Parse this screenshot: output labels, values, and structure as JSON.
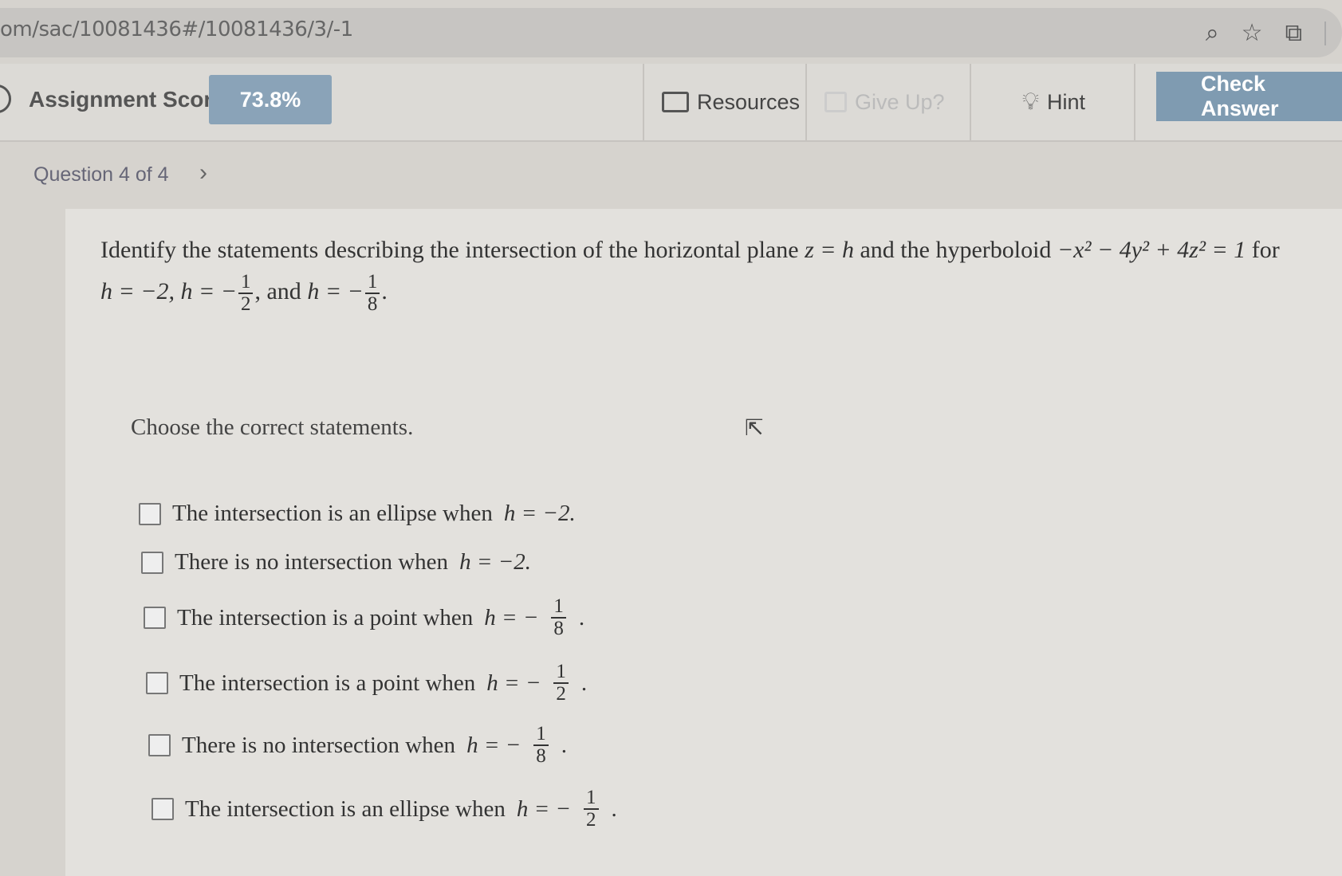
{
  "browser": {
    "url": "om/sac/10081436#/10081436/3/-1"
  },
  "toolbar": {
    "score_label": "Assignment Score:",
    "score_value": "73.8%",
    "resources_label": "Resources",
    "giveup_label": "Give Up?",
    "hint_label": "Hint",
    "check_label": "Check Answer"
  },
  "question": {
    "nav_label": "Question 4 of 4",
    "prompt_start": "Identify the statements describing the intersection of the horizontal plane",
    "prompt_plane": "z = h",
    "prompt_mid": "and the hyperboloid",
    "prompt_surface": "−x² − 4y² + 4z² = 1",
    "prompt_for": "for",
    "h_values_a": "h = −2, h = −",
    "and_text": ", and",
    "h_equals_neg": "h = −",
    "choose_text": "Choose the correct statements."
  },
  "options": [
    {
      "text": "The intersection is an ellipse when",
      "math": "h = −2."
    },
    {
      "text": "There is no intersection when",
      "math": "h = −2."
    },
    {
      "text": "The intersection is a point when",
      "math": "h = −",
      "num": "1",
      "den": "8"
    },
    {
      "text": "The intersection is a point when",
      "math": "h = −",
      "num": "1",
      "den": "2"
    },
    {
      "text": "There is no intersection when",
      "math": "h = −",
      "num": "1",
      "den": "8"
    },
    {
      "text": "The intersection is an ellipse when",
      "math": "h = −",
      "num": "1",
      "den": "2"
    }
  ],
  "fractions": {
    "one": "1",
    "two": "2",
    "eight": "8"
  },
  "icons": {
    "search": "magnifier-icon",
    "star": "star-icon",
    "extension": "puzzle-icon",
    "resources": "folder-icon",
    "hint": "lightbulb-icon"
  }
}
